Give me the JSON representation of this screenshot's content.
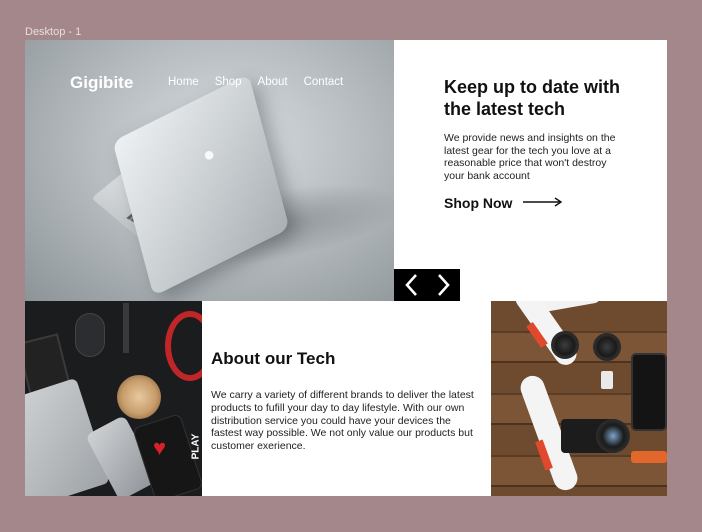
{
  "canvas": {
    "frame_label": "Desktop - 1"
  },
  "nav": {
    "brand": "Gigibite",
    "links": [
      "Home",
      "Shop",
      "About",
      "Contact"
    ]
  },
  "hero": {
    "title": "Keep up to date with the latest tech",
    "body": "We provide news and insights on the latest gear for the tech you love at a reasonable price that won't destroy your bank account",
    "cta_label": "Shop Now",
    "image_icon": "apple-logo-icon"
  },
  "carousel": {
    "prev_icon": "chevron-left-icon",
    "next_icon": "chevron-right-icon"
  },
  "about": {
    "title": "About our Tech",
    "body": "We carry a variety of different brands to deliver the latest products to fufill your day to day lifestyle. With our own distribution service you could have your devices the fastest way possible. We not only value our products but customer exerience."
  },
  "desk_image": {
    "printed_text": "PLAY"
  },
  "colors": {
    "canvas_bg": "#a3878a",
    "frame_bg": "#ffffff",
    "text": "#111111",
    "carousel_bg": "#000000",
    "accent_red": "#d92027"
  }
}
